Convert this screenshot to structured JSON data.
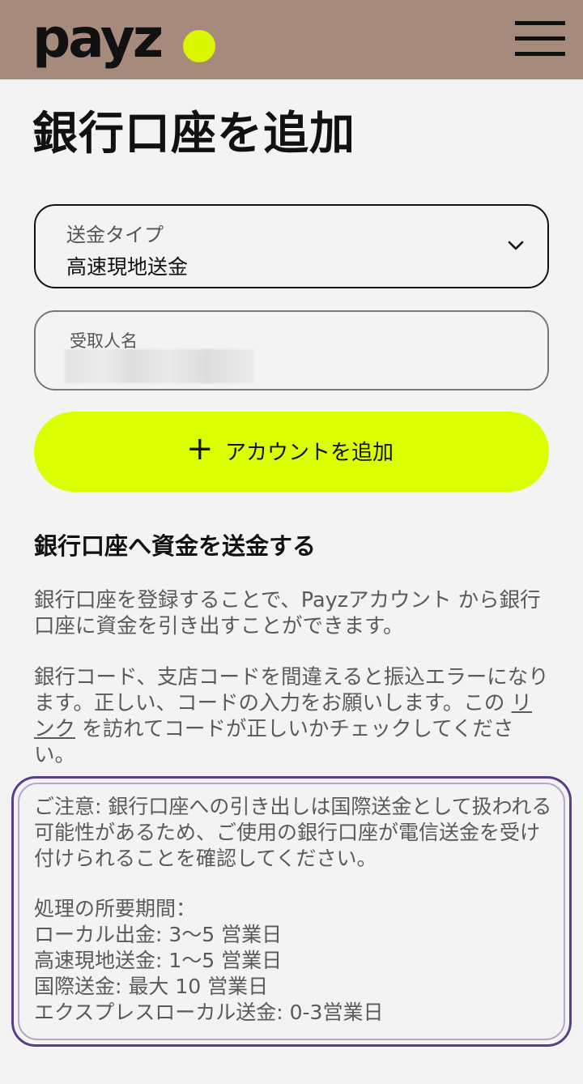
{
  "header": {
    "logo_text": "payz",
    "accent_color": "#dcff00",
    "background_color": "#a68b7c",
    "menu_icon": "hamburger-menu-icon"
  },
  "page": {
    "title": "銀行口座を追加"
  },
  "form": {
    "transfer_type": {
      "label": "送金タイプ",
      "value": "高速現地送金",
      "icon": "chevron-down-icon"
    },
    "recipient_name": {
      "label": "受取人名",
      "value_redacted": true
    },
    "add_account_button": {
      "icon": "+",
      "label": "アカウントを追加"
    }
  },
  "info": {
    "section_title": "銀行口座へ資金を送金する",
    "paragraph1": "銀行口座を登録することで、Payzアカウント から銀行口座に資金を引き出すことができます。",
    "paragraph2_before": "銀行コード、支店コードを間違えると振込エラーになります。正しい、コードの入力をお願いします。この ",
    "paragraph2_link": "リンク",
    "paragraph2_after": " を訪れてコードが正しいかチェックしてください。"
  },
  "notice": {
    "caution": "ご注意: 銀行口座への引き出しは国際送金として扱われる可能性があるため、ご使用の銀行口座が電信送金を受け付けられることを確認してください。",
    "processing_title": "処理の所要期間：",
    "items": [
      "ローカル出金: 3〜5 営業日",
      "高速現地送金: 1〜5 営業日",
      "国際送金: 最大 10 営業日",
      "エクスプレスローカル送金: 0-3営業日"
    ],
    "border_color": "#5b3d8a"
  }
}
